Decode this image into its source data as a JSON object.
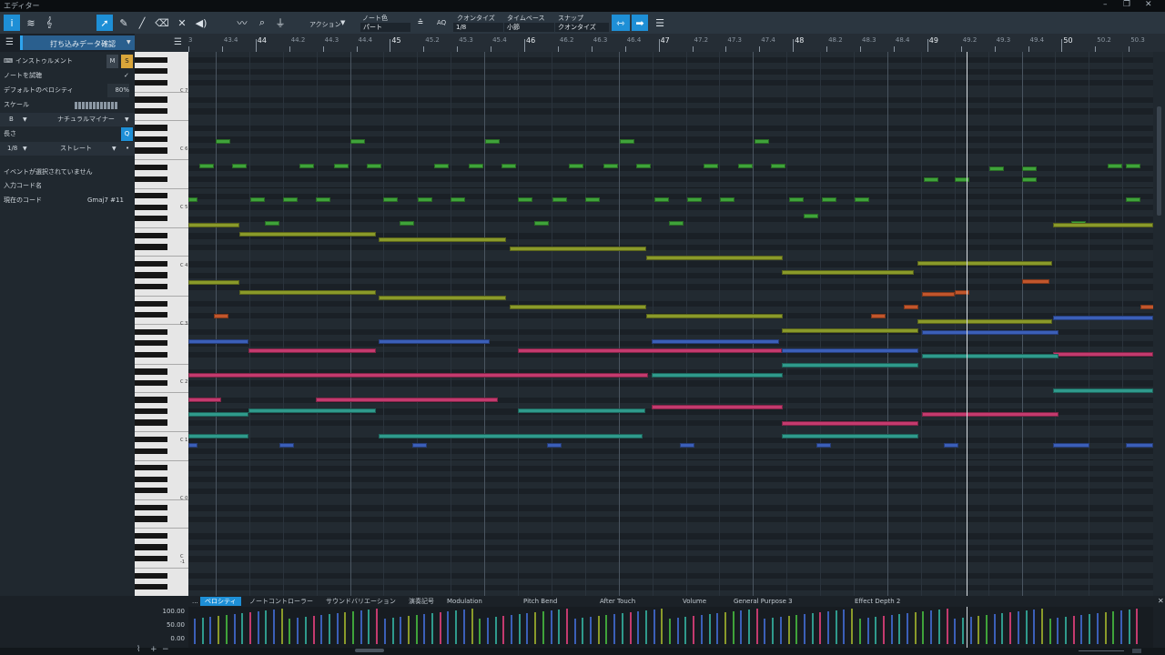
{
  "window": {
    "title": "エディター",
    "controls": [
      "–",
      "❐",
      "✕"
    ]
  },
  "toolbar": {
    "action_label": "アクション",
    "note_color_label": "ノート色",
    "note_color_value": "パート",
    "aq_label": "AQ",
    "quantize_label": "クオンタイズ",
    "quantize_value": "1/8",
    "timebase_label": "タイムベース",
    "timebase_value": "小節",
    "snap_label": "スナップ",
    "snap_value": "クオンタイズ"
  },
  "left_panel": {
    "track_name": "打ち込みデータ確認",
    "instrument_label": "インストゥルメント",
    "mute_label": "M",
    "solo_label": "S",
    "audition_label": "ノートを試聴",
    "audition_check": "✓",
    "default_velocity_label": "デフォルトのベロシティ",
    "default_velocity_value": "80%",
    "scale_label": "スケール",
    "scale_root": "B",
    "scale_type": "ナチュラルマイナー",
    "length_label": "長さ",
    "length_value": "1/8",
    "length_mode": "ストレート",
    "no_selection": "イベントが選択されていません",
    "input_chord_label": "入力コード名",
    "current_chord_label": "現在のコード",
    "current_chord_value": "Gmaj7 #11"
  },
  "ruler": {
    "labels": [
      "3",
      "43.4",
      "44",
      "44.2",
      "44.3",
      "44.4",
      "45",
      "45.2",
      "45.3",
      "45.4",
      "46",
      "46.2",
      "46.3",
      "46.4",
      "47",
      "47.2",
      "47.3",
      "47.4",
      "48",
      "48.2",
      "48.3",
      "48.4",
      "49",
      "49.2",
      "49.3",
      "49.4",
      "50",
      "50.2",
      "50.3"
    ]
  },
  "piano": {
    "octave_labels": [
      "C 7",
      "C 6",
      "C 5",
      "C 4",
      "C 3",
      "C 2",
      "C 1",
      "C 0",
      "C -1"
    ]
  },
  "lanes": {
    "more": "...",
    "tabs": [
      "ベロシティ",
      "ノートコントローラー",
      "サウンドバリエーション",
      "演奏記号",
      "Modulation",
      "Pitch Bend",
      "After Touch",
      "Volume",
      "General Purpose 3",
      "Effect Depth 2"
    ],
    "active_tab": "ベロシティ",
    "scale_labels": [
      "100.00",
      "50.00",
      "0.00"
    ]
  },
  "colors": {
    "accent": "#1e8fd6",
    "green": "#3fa33a",
    "olive": "#8a9a2a",
    "blue": "#3b5fb8",
    "magenta": "#c43a6e",
    "teal": "#2f9a8c",
    "orange": "#c2562c"
  }
}
